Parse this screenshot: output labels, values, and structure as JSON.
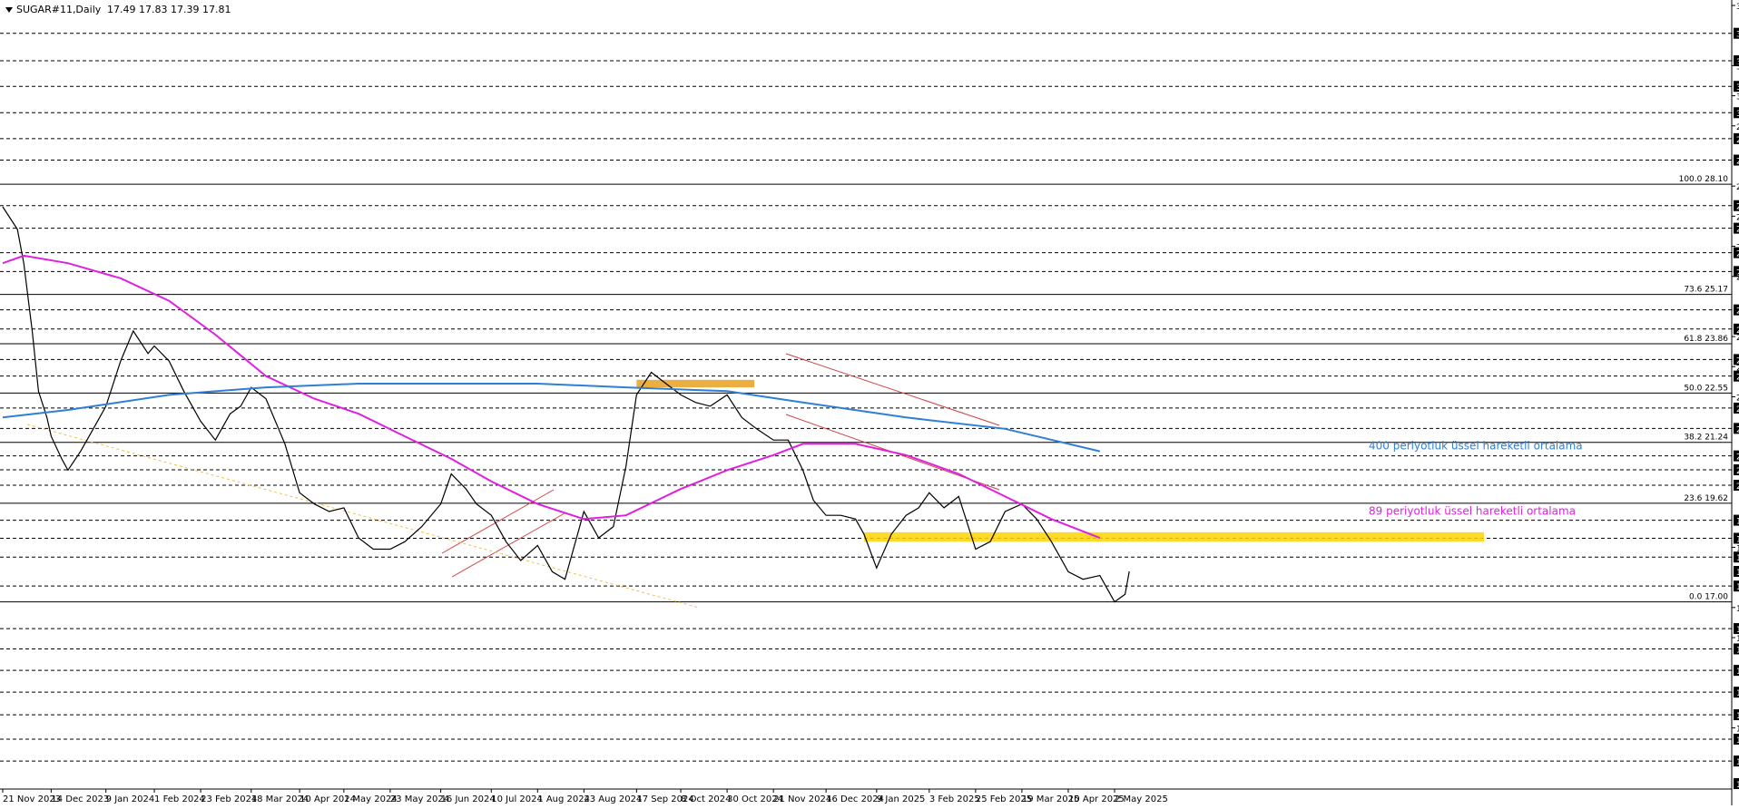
{
  "header": {
    "symbol_label": "SUGAR#11,Daily",
    "ohlc": "17.49 17.83 17.39 17.81"
  },
  "chart_data": {
    "type": "line",
    "title": "SUGAR#11,Daily",
    "ylim": [
      12.17,
      32.85
    ],
    "y_axis_ticks": [
      {
        "value": 32.85,
        "boxed": false
      },
      {
        "value": 32.11,
        "boxed": true
      },
      {
        "value": 31.38,
        "boxed": true
      },
      {
        "value": 31.25,
        "boxed": false
      },
      {
        "value": 30.7,
        "boxed": true
      },
      {
        "value": 30.45,
        "boxed": false
      },
      {
        "value": 30.0,
        "boxed": true
      },
      {
        "value": 29.65,
        "boxed": false
      },
      {
        "value": 29.31,
        "boxed": true
      },
      {
        "value": 28.74,
        "boxed": true
      },
      {
        "value": 28.05,
        "boxed": false
      },
      {
        "value": 27.53,
        "boxed": true
      },
      {
        "value": 27.25,
        "boxed": false
      },
      {
        "value": 26.93,
        "boxed": true
      },
      {
        "value": 26.45,
        "boxed": false
      },
      {
        "value": 26.28,
        "boxed": true
      },
      {
        "value": 25.78,
        "boxed": true
      },
      {
        "value": 25.65,
        "boxed": false
      },
      {
        "value": 24.76,
        "boxed": true
      },
      {
        "value": 24.25,
        "boxed": true
      },
      {
        "value": 24.05,
        "boxed": false
      },
      {
        "value": 23.44,
        "boxed": true
      },
      {
        "value": 23.25,
        "boxed": false
      },
      {
        "value": 23.0,
        "boxed": true
      },
      {
        "value": 22.45,
        "boxed": false
      },
      {
        "value": 22.15,
        "boxed": true
      },
      {
        "value": 21.61,
        "boxed": true
      },
      {
        "value": 20.88,
        "boxed": true
      },
      {
        "value": 20.51,
        "boxed": true
      },
      {
        "value": 20.1,
        "boxed": true
      },
      {
        "value": 19.17,
        "boxed": true
      },
      {
        "value": 18.69,
        "boxed": true
      },
      {
        "value": 18.45,
        "boxed": false
      },
      {
        "value": 18.19,
        "boxed": true
      },
      {
        "value": 17.81,
        "boxed": true,
        "current": true
      },
      {
        "value": 17.42,
        "boxed": true
      },
      {
        "value": 16.85,
        "boxed": false
      },
      {
        "value": 16.29,
        "boxed": true
      },
      {
        "value": 16.05,
        "boxed": false
      },
      {
        "value": 15.75,
        "boxed": true
      },
      {
        "value": 15.18,
        "boxed": true
      },
      {
        "value": 14.6,
        "boxed": true
      },
      {
        "value": 14.0,
        "boxed": true
      },
      {
        "value": 13.65,
        "boxed": false
      },
      {
        "value": 13.35,
        "boxed": true
      },
      {
        "value": 12.77,
        "boxed": true
      },
      {
        "value": 12.17,
        "boxed": true
      }
    ],
    "x_axis_labels": [
      "21 Nov 2023",
      "14 Dec 2023",
      "9 Jan 2024",
      "1 Feb 2024",
      "23 Feb 2024",
      "18 Mar 2024",
      "10 Apr 2024",
      "1 May 2024",
      "23 May 2024",
      "16 Jun 2024",
      "10 Jul 2024",
      "1 Aug 2024",
      "23 Aug 2024",
      "17 Sep 2024",
      "8 Oct 2024",
      "30 Oct 2024",
      "21 Nov 2024",
      "16 Dec 2024",
      "9 Jan 2025",
      "3 Feb 2025",
      "25 Feb 2025",
      "19 Mar 2025",
      "10 Apr 2025",
      "2 May 2025"
    ],
    "dashed_horizontal_levels": [
      32.11,
      31.38,
      30.7,
      30.0,
      29.31,
      28.74,
      27.53,
      26.93,
      26.28,
      25.78,
      24.76,
      24.25,
      23.44,
      23.0,
      22.15,
      21.61,
      20.88,
      20.51,
      20.1,
      19.17,
      18.69,
      18.19,
      17.42,
      16.29,
      15.75,
      15.18,
      14.6,
      14.0,
      13.35,
      12.77
    ],
    "fibonacci": {
      "levels": [
        {
          "label": "100.0 28.10",
          "value": 28.1
        },
        {
          "label": "73.6 25.17",
          "value": 25.17
        },
        {
          "label": "61.8 23.86",
          "value": 23.86
        },
        {
          "label": "50.0 22.55",
          "value": 22.55
        },
        {
          "label": "38.2 21.24",
          "value": 21.24
        },
        {
          "label": "23.6 19.62",
          "value": 19.62
        },
        {
          "label": "0.0 17.00",
          "value": 17.0
        }
      ]
    },
    "series": [
      {
        "name": "Price",
        "color": "#000000",
        "points": [
          {
            "date": "21 Nov 2023",
            "value": 27.5
          },
          {
            "date": "28 Nov 2023",
            "value": 26.9
          },
          {
            "date": "1 Dec 2023",
            "value": 26.0
          },
          {
            "date": "5 Dec 2023",
            "value": 24.2
          },
          {
            "date": "8 Dec 2023",
            "value": 22.6
          },
          {
            "date": "12 Dec 2023",
            "value": 21.9
          },
          {
            "date": "14 Dec 2023",
            "value": 21.4
          },
          {
            "date": "19 Dec 2023",
            "value": 20.8
          },
          {
            "date": "22 Dec 2023",
            "value": 20.5
          },
          {
            "date": "28 Dec 2023",
            "value": 21.0
          },
          {
            "date": "3 Jan 2024",
            "value": 21.6
          },
          {
            "date": "9 Jan 2024",
            "value": 22.2
          },
          {
            "date": "16 Jan 2024",
            "value": 23.4
          },
          {
            "date": "22 Jan 2024",
            "value": 24.2
          },
          {
            "date": "29 Jan 2024",
            "value": 23.6
          },
          {
            "date": "1 Feb 2024",
            "value": 23.8
          },
          {
            "date": "8 Feb 2024",
            "value": 23.4
          },
          {
            "date": "15 Feb 2024",
            "value": 22.6
          },
          {
            "date": "23 Feb 2024",
            "value": 21.8
          },
          {
            "date": "1 Mar 2024",
            "value": 21.3
          },
          {
            "date": "8 Mar 2024",
            "value": 22.0
          },
          {
            "date": "13 Mar 2024",
            "value": 22.2
          },
          {
            "date": "18 Mar 2024",
            "value": 22.7
          },
          {
            "date": "25 Mar 2024",
            "value": 22.4
          },
          {
            "date": "3 Apr 2024",
            "value": 21.2
          },
          {
            "date": "10 Apr 2024",
            "value": 19.9
          },
          {
            "date": "17 Apr 2024",
            "value": 19.6
          },
          {
            "date": "24 Apr 2024",
            "value": 19.4
          },
          {
            "date": "1 May 2024",
            "value": 19.5
          },
          {
            "date": "8 May 2024",
            "value": 18.7
          },
          {
            "date": "15 May 2024",
            "value": 18.4
          },
          {
            "date": "23 May 2024",
            "value": 18.4
          },
          {
            "date": "30 May 2024",
            "value": 18.6
          },
          {
            "date": "7 Jun 2024",
            "value": 19.0
          },
          {
            "date": "16 Jun 2024",
            "value": 19.6
          },
          {
            "date": "21 Jun 2024",
            "value": 20.4
          },
          {
            "date": "28 Jun 2024",
            "value": 20.0
          },
          {
            "date": "3 Jul 2024",
            "value": 19.6
          },
          {
            "date": "10 Jul 2024",
            "value": 19.3
          },
          {
            "date": "17 Jul 2024",
            "value": 18.6
          },
          {
            "date": "24 Jul 2024",
            "value": 18.1
          },
          {
            "date": "1 Aug 2024",
            "value": 18.5
          },
          {
            "date": "8 Aug 2024",
            "value": 17.8
          },
          {
            "date": "14 Aug 2024",
            "value": 17.6
          },
          {
            "date": "19 Aug 2024",
            "value": 18.6
          },
          {
            "date": "23 Aug 2024",
            "value": 19.4
          },
          {
            "date": "30 Aug 2024",
            "value": 18.7
          },
          {
            "date": "6 Sep 2024",
            "value": 19.0
          },
          {
            "date": "12 Sep 2024",
            "value": 20.6
          },
          {
            "date": "17 Sep 2024",
            "value": 22.5
          },
          {
            "date": "24 Sep 2024",
            "value": 23.1
          },
          {
            "date": "1 Oct 2024",
            "value": 22.8
          },
          {
            "date": "8 Oct 2024",
            "value": 22.5
          },
          {
            "date": "15 Oct 2024",
            "value": 22.3
          },
          {
            "date": "22 Oct 2024",
            "value": 22.2
          },
          {
            "date": "30 Oct 2024",
            "value": 22.5
          },
          {
            "date": "6 Nov 2024",
            "value": 21.9
          },
          {
            "date": "13 Nov 2024",
            "value": 21.6
          },
          {
            "date": "21 Nov 2024",
            "value": 21.3
          },
          {
            "date": "28 Nov 2024",
            "value": 21.3
          },
          {
            "date": "5 Dec 2024",
            "value": 20.5
          },
          {
            "date": "10 Dec 2024",
            "value": 19.7
          },
          {
            "date": "16 Dec 2024",
            "value": 19.3
          },
          {
            "date": "23 Dec 2024",
            "value": 19.3
          },
          {
            "date": "30 Dec 2024",
            "value": 19.2
          },
          {
            "date": "3 Jan 2025",
            "value": 18.8
          },
          {
            "date": "9 Jan 2025",
            "value": 17.9
          },
          {
            "date": "16 Jan 2025",
            "value": 18.8
          },
          {
            "date": "23 Jan 2025",
            "value": 19.3
          },
          {
            "date": "29 Jan 2025",
            "value": 19.5
          },
          {
            "date": "3 Feb 2025",
            "value": 19.9
          },
          {
            "date": "10 Feb 2025",
            "value": 19.5
          },
          {
            "date": "17 Feb 2025",
            "value": 19.8
          },
          {
            "date": "25 Feb 2025",
            "value": 18.4
          },
          {
            "date": "4 Mar 2025",
            "value": 18.6
          },
          {
            "date": "11 Mar 2025",
            "value": 19.4
          },
          {
            "date": "19 Mar 2025",
            "value": 19.6
          },
          {
            "date": "26 Mar 2025",
            "value": 19.2
          },
          {
            "date": "2 Apr 2025",
            "value": 18.6
          },
          {
            "date": "10 Apr 2025",
            "value": 17.8
          },
          {
            "date": "17 Apr 2025",
            "value": 17.6
          },
          {
            "date": "25 Apr 2025",
            "value": 17.7
          },
          {
            "date": "2 May 2025",
            "value": 17.0
          },
          {
            "date": "7 May 2025",
            "value": 17.2
          },
          {
            "date": "9 May 2025",
            "value": 17.81
          }
        ]
      },
      {
        "name": "89 periyotluk üssel hareketli ortalama",
        "color": "#e020e0",
        "points": [
          {
            "date": "21 Nov 2023",
            "value": 26.0
          },
          {
            "date": "1 Dec 2023",
            "value": 26.2
          },
          {
            "date": "22 Dec 2023",
            "value": 26.0
          },
          {
            "date": "16 Jan 2024",
            "value": 25.6
          },
          {
            "date": "8 Feb 2024",
            "value": 25.0
          },
          {
            "date": "1 Mar 2024",
            "value": 24.1
          },
          {
            "date": "25 Mar 2024",
            "value": 23.0
          },
          {
            "date": "17 Apr 2024",
            "value": 22.4
          },
          {
            "date": "8 May 2024",
            "value": 22.0
          },
          {
            "date": "30 May 2024",
            "value": 21.4
          },
          {
            "date": "21 Jun 2024",
            "value": 20.8
          },
          {
            "date": "10 Jul 2024",
            "value": 20.2
          },
          {
            "date": "1 Aug 2024",
            "value": 19.6
          },
          {
            "date": "23 Aug 2024",
            "value": 19.2
          },
          {
            "date": "12 Sep 2024",
            "value": 19.3
          },
          {
            "date": "8 Oct 2024",
            "value": 20.0
          },
          {
            "date": "30 Oct 2024",
            "value": 20.5
          },
          {
            "date": "21 Nov 2024",
            "value": 20.9
          },
          {
            "date": "5 Dec 2024",
            "value": 21.2
          },
          {
            "date": "30 Dec 2024",
            "value": 21.2
          },
          {
            "date": "23 Jan 2025",
            "value": 20.9
          },
          {
            "date": "17 Feb 2025",
            "value": 20.4
          },
          {
            "date": "11 Mar 2025",
            "value": 19.8
          },
          {
            "date": "2 Apr 2025",
            "value": 19.2
          },
          {
            "date": "25 Apr 2025",
            "value": 18.7
          }
        ]
      },
      {
        "name": "400 periyotluk üssel hareketli ortalama",
        "color": "#2f7fd6",
        "points": [
          {
            "date": "21 Nov 2023",
            "value": 21.9
          },
          {
            "date": "22 Dec 2023",
            "value": 22.1
          },
          {
            "date": "8 Feb 2024",
            "value": 22.5
          },
          {
            "date": "25 Mar 2024",
            "value": 22.7
          },
          {
            "date": "8 May 2024",
            "value": 22.8
          },
          {
            "date": "21 Jun 2024",
            "value": 22.8
          },
          {
            "date": "1 Aug 2024",
            "value": 22.8
          },
          {
            "date": "12 Sep 2024",
            "value": 22.7
          },
          {
            "date": "30 Oct 2024",
            "value": 22.6
          },
          {
            "date": "5 Dec 2024",
            "value": 22.3
          },
          {
            "date": "23 Jan 2025",
            "value": 21.9
          },
          {
            "date": "11 Mar 2025",
            "value": 21.6
          },
          {
            "date": "25 Apr 2025",
            "value": 21.0
          }
        ]
      }
    ],
    "annotations": [
      {
        "text": "400 periyotluk üssel hareketli ortalama",
        "color": "#2f7fd6"
      },
      {
        "text": "89 periyotluk üssel hareketli ortalama",
        "color": "#e020e0"
      }
    ],
    "zones": [
      {
        "name": "support-zone",
        "color": "#ffd400",
        "y_range": [
          18.6,
          18.85
        ]
      },
      {
        "name": "orange-zone",
        "color": "#e8a020",
        "y_range": [
          22.7,
          22.9
        ]
      }
    ],
    "grid": false,
    "legend": "none"
  }
}
